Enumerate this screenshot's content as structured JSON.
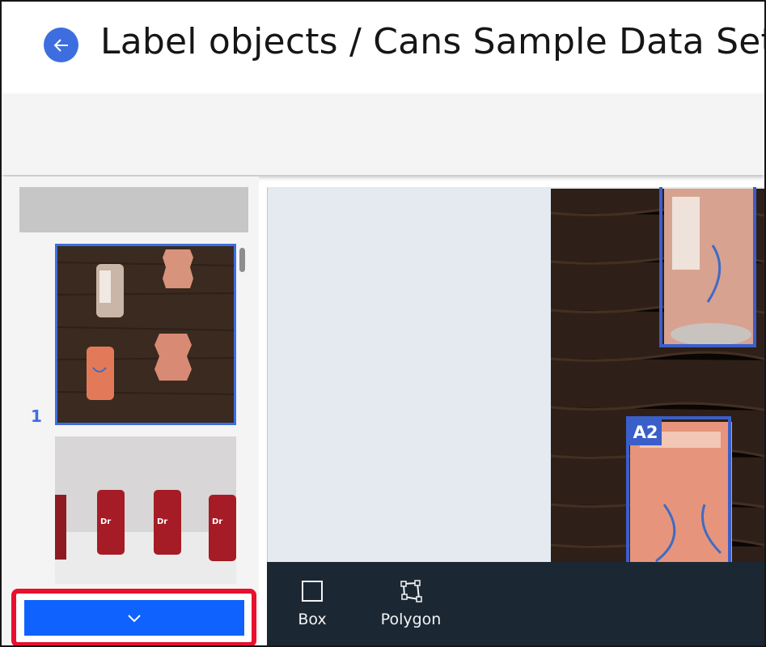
{
  "header": {
    "title": "Label objects / Cans Sample Data Set",
    "back_icon": "arrow-left-icon",
    "accent": "#3d6ee0"
  },
  "sidebar": {
    "thumbnails": [
      {
        "index": "1",
        "selected": true,
        "description_icon": "image-thumbnail"
      },
      {
        "index": "",
        "selected": false,
        "description_icon": "image-thumbnail"
      }
    ],
    "expand_icon": "chevron-down-icon",
    "expand_color": "#0f62fe",
    "highlight_color": "#e8102f"
  },
  "canvas": {
    "annotations": [
      {
        "label": "",
        "color": "#3b5fc9"
      },
      {
        "label": "A2",
        "color": "#3b5fc9"
      }
    ]
  },
  "tools": {
    "box_label": "Box",
    "polygon_label": "Polygon",
    "box_icon": "square-icon",
    "polygon_icon": "polygon-icon"
  }
}
